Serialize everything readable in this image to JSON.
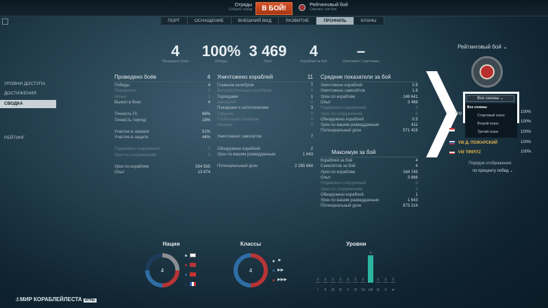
{
  "topbar": {
    "squad_title": "Отряды",
    "squad_sub": "Собрать отряд",
    "battle_button": "В БОЙ!",
    "mode_title": "Рейтинговый бой",
    "mode_sub": "Сменить тип боя"
  },
  "tabs": [
    "ПОРТ",
    "ОСНАЩЕНИЕ",
    "ВНЕШНИЙ ВИД",
    "РАЗВИТИЕ",
    "ПРОФИЛЬ",
    "КЛАНЫ"
  ],
  "nav": {
    "access_levels": "УРОВНИ ДОСТУПА",
    "achievements": "ДОСТИЖЕНИЯ",
    "summary": "СВОДКА",
    "rating": "РЕЙТИНГ"
  },
  "summary_stats": [
    {
      "value": "4",
      "label": "Проведено боёв"
    },
    {
      "value": "100%",
      "label": "Победы"
    },
    {
      "value": "3 469",
      "label": "Опыт"
    },
    {
      "value": "4",
      "label": "Кораблей за бой"
    },
    {
      "value": "–",
      "label": "Уничтожил / уничтожен"
    }
  ],
  "battles": {
    "title": "Проведено боёв",
    "total": "4",
    "rows": [
      {
        "label": "Победы",
        "value": "4"
      },
      {
        "label": "Поражения",
        "value": "0"
      },
      {
        "label": "Ничьи",
        "value": "0"
      },
      {
        "label": "Выжил в боях",
        "value": "4"
      },
      {
        "label": "Точность ГК",
        "value": "66%"
      },
      {
        "label": "Точность торпед",
        "value": "18%"
      },
      {
        "label": "Участие в захвате",
        "value": "51%"
      },
      {
        "label": "Участие в защите",
        "value": "44%"
      },
      {
        "label": "Подавлено сооружений",
        "value": "0"
      },
      {
        "label": "Урон по сооружениям",
        "value": "0"
      },
      {
        "label": "Урон по кораблям",
        "value": "594 565"
      },
      {
        "label": "Опыт",
        "value": "13 874"
      }
    ]
  },
  "destroyed": {
    "title": "Уничтожено кораблей",
    "total": "11",
    "rows": [
      {
        "label": "Главным калибром",
        "value": "7"
      },
      {
        "label": "Вспомогательным калибром",
        "value": "0"
      },
      {
        "label": "Торпедами",
        "value": "1"
      },
      {
        "label": "Авиацией",
        "value": "0"
      },
      {
        "label": "Пожарами и затоплениями",
        "value": "3"
      },
      {
        "label": "Тараном",
        "value": "0"
      },
      {
        "label": "Глубинными бомбами",
        "value": "0"
      },
      {
        "label": "Минами",
        "value": "0"
      },
      {
        "label": "Уничтожено самолётов",
        "value": "7"
      },
      {
        "label": "Обнаружено кораблей",
        "value": "2"
      },
      {
        "label": "Урон по вашим разведданным",
        "value": "1 643"
      },
      {
        "label": "Потенциальный урон",
        "value": "2 285 664"
      }
    ]
  },
  "average": {
    "title": "Средние показатели за бой",
    "rows": [
      {
        "label": "Уничтожено кораблей",
        "value": "2.8"
      },
      {
        "label": "Уничтожено самолётов",
        "value": "1.8"
      },
      {
        "label": "Урон по кораблям",
        "value": "148 641"
      },
      {
        "label": "Опыт",
        "value": "3 469"
      },
      {
        "label": "Подавлено сооружений",
        "value": "0"
      },
      {
        "label": "Урон по сооружениям",
        "value": "0"
      },
      {
        "label": "Обнаружено кораблей",
        "value": "0.5"
      },
      {
        "label": "Урон по вашим разведданным",
        "value": "411"
      },
      {
        "label": "Потенциальный урон",
        "value": "571 416"
      }
    ]
  },
  "maximum": {
    "title": "Максимум за бой",
    "rows": [
      {
        "label": "Кораблей за бой",
        "value": "4"
      },
      {
        "label": "Самолётов за бой",
        "value": "4"
      },
      {
        "label": "Урон по кораблям",
        "value": "164 745"
      },
      {
        "label": "Опыт",
        "value": "3 866"
      },
      {
        "label": "Подавлено сооружений",
        "value": "0"
      },
      {
        "label": "Урон по сооружениям",
        "value": "0"
      },
      {
        "label": "Обнаружено кораблей",
        "value": "1"
      },
      {
        "label": "Урон по вашим разведданным",
        "value": "1 643"
      },
      {
        "label": "Потенциальный урон",
        "value": "873 214"
      }
    ]
  },
  "right": {
    "rating_title": "Рейтинговый бой",
    "dropdown_value": "Все сезоны",
    "dropdown_options": [
      "Все сезоны",
      "Стартовый сезон",
      "Второй сезон",
      "Третий сезон"
    ],
    "partial_label": "Кор",
    "ships": [
      {
        "name": "",
        "pct": "100%"
      },
      {
        "name": "",
        "pct": "100%"
      },
      {
        "name": "",
        "pct": "100%"
      },
      {
        "name": "VIII Д. ПОЖАРСКИЙ",
        "pct": "100%"
      },
      {
        "name": "VIII TIRPITZ",
        "pct": "100%"
      }
    ],
    "sort_label": "Порядок отображения:",
    "sort_value": "по проценту побед"
  },
  "bottom": {
    "nations_title": "Нации",
    "nations_center": "4",
    "classes_title": "Классы",
    "classes_center": "4",
    "levels_title": "Уровни",
    "levels_labels": [
      "I",
      "II",
      "III",
      "IV",
      "V",
      "VI",
      "VII",
      "VIII",
      "IX",
      "X",
      "★"
    ],
    "levels_values": [
      0,
      0,
      0,
      0,
      0,
      0,
      0,
      4,
      0,
      0,
      0
    ]
  },
  "logos": {
    "game": "МИР КОРАБЛЕЙ",
    "studio": "ЛЕСТА",
    "studio_tag": "ИГРЫ"
  },
  "colors": {
    "accent_teal": "#2bb5a0",
    "battle_red": "#c7461f",
    "donut_dark": "#8b8f92",
    "donut_blue": "#2f6da6",
    "donut_red": "#b73434"
  }
}
